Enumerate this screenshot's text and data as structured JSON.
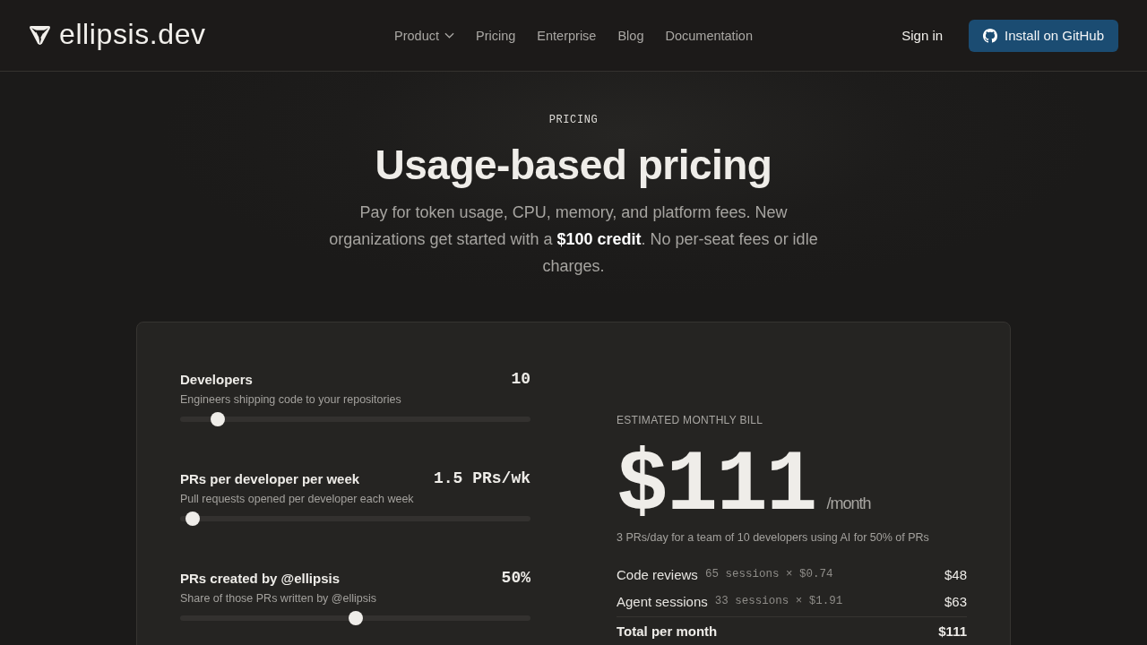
{
  "header": {
    "logo": "ellipsis.dev",
    "nav": [
      {
        "label": "Product",
        "dropdown": true
      },
      {
        "label": "Pricing",
        "dropdown": false
      },
      {
        "label": "Enterprise",
        "dropdown": false
      },
      {
        "label": "Blog",
        "dropdown": false
      },
      {
        "label": "Documentation",
        "dropdown": false
      }
    ],
    "sign_in": "Sign in",
    "install_button": "Install on GitHub"
  },
  "hero": {
    "eyebrow": "PRICING",
    "title": "Usage-based pricing",
    "subtitle": "Pay for token usage, CPU, memory, and platform fees. New organizations get started with a **$100 credit**. No per-seat fees or idle charges."
  },
  "calculator": {
    "sliders": [
      {
        "label": "Developers",
        "description": "Engineers shipping code to your repositories",
        "value": "10",
        "level": 0.09
      },
      {
        "label": "PRs per developer per week",
        "description": "Pull requests opened per developer each week",
        "value": "1.5 PRs/wk",
        "level": 0.016
      },
      {
        "label": "PRs created by @ellipsis",
        "description": "Share of those PRs written by @ellipsis",
        "value": "50%",
        "level": 0.5
      }
    ],
    "bill": {
      "caption": "ESTIMATED MONTHLY BILL",
      "amount": "$111",
      "period": "/month",
      "summary": "3 PRs/day for a team of 10 developers using AI for 50% of PRs",
      "lines": [
        {
          "name": "Code reviews",
          "detail": "65 sessions × $0.74",
          "amount": "$48"
        },
        {
          "name": "Agent sessions",
          "detail": "33 sessions × $1.91",
          "amount": "$63"
        }
      ],
      "total": {
        "label": "Total per month",
        "amount": "$111"
      }
    }
  }
}
